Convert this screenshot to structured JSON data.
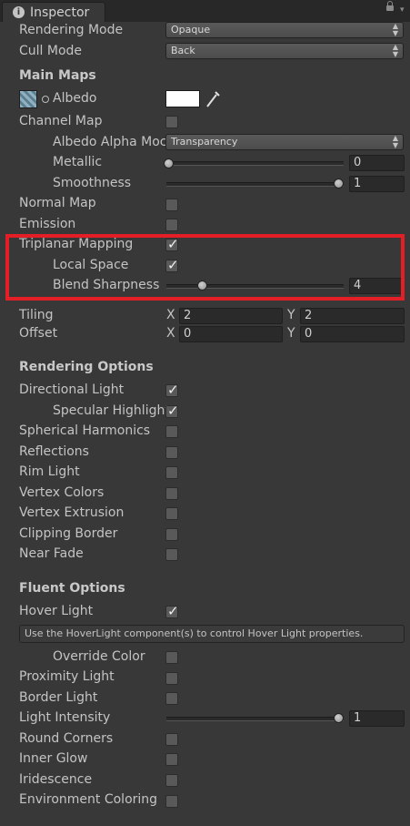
{
  "window": {
    "tab_title": "Inspector",
    "tab_icon": "info-icon"
  },
  "rendering_mode": {
    "label": "Rendering Mode",
    "value": "Opaque"
  },
  "cull_mode": {
    "label": "Cull Mode",
    "value": "Back"
  },
  "main_maps": {
    "header": "Main Maps",
    "albedo_label": "Albedo",
    "albedo_color": "#ffffff",
    "channel_map": "Channel Map",
    "albedo_alpha": {
      "label": "Albedo Alpha Moc",
      "value": "Transparency"
    },
    "metallic": {
      "label": "Metallic",
      "value": "0",
      "fraction": 0
    },
    "smoothness": {
      "label": "Smoothness",
      "value": "1",
      "fraction": 1
    },
    "normal_map": "Normal Map",
    "emission": "Emission",
    "triplanar": {
      "label": "Triplanar Mapping",
      "checked": true
    },
    "local_space": {
      "label": "Local Space",
      "checked": true
    },
    "blend_sharpness": {
      "label": "Blend Sharpness",
      "value": "4"
    }
  },
  "tiling": {
    "label": "Tiling",
    "x_label": "X",
    "x": "2",
    "y_label": "Y",
    "y": "2"
  },
  "offset": {
    "label": "Offset",
    "x_label": "X",
    "x": "0",
    "y_label": "Y",
    "y": "0"
  },
  "rendering_options": {
    "header": "Rendering Options",
    "items": [
      {
        "label": "Directional Light",
        "checked": true
      },
      {
        "label": "Specular Highlight",
        "checked": true
      },
      {
        "label": "Spherical Harmonics",
        "checked": false
      },
      {
        "label": "Reflections",
        "checked": false
      },
      {
        "label": "Rim Light",
        "checked": false
      },
      {
        "label": "Vertex Colors",
        "checked": false
      },
      {
        "label": "Vertex Extrusion",
        "checked": false
      },
      {
        "label": "Clipping Border",
        "checked": false
      },
      {
        "label": "Near Fade",
        "checked": false
      }
    ]
  },
  "fluent_options": {
    "header": "Fluent Options",
    "hover_light": {
      "label": "Hover Light",
      "checked": true
    },
    "help_text": "Use the HoverLight component(s) to control Hover Light properties.",
    "override_color": {
      "label": "Override Color",
      "checked": false
    },
    "proximity_light": {
      "label": "Proximity Light",
      "checked": false
    },
    "border_light": {
      "label": "Border Light",
      "checked": false
    },
    "light_intensity": {
      "label": "Light Intensity",
      "value": "1",
      "fraction": 1
    },
    "round_corners": {
      "label": "Round Corners",
      "checked": false
    },
    "inner_glow": {
      "label": "Inner Glow",
      "checked": false
    },
    "iridescence": {
      "label": "Iridescence",
      "checked": false
    },
    "environment_coloring": {
      "label": "Environment Coloring",
      "checked": false
    }
  },
  "accent": {
    "highlight_border": "#e31e26",
    "panel_bg": "#383838"
  }
}
